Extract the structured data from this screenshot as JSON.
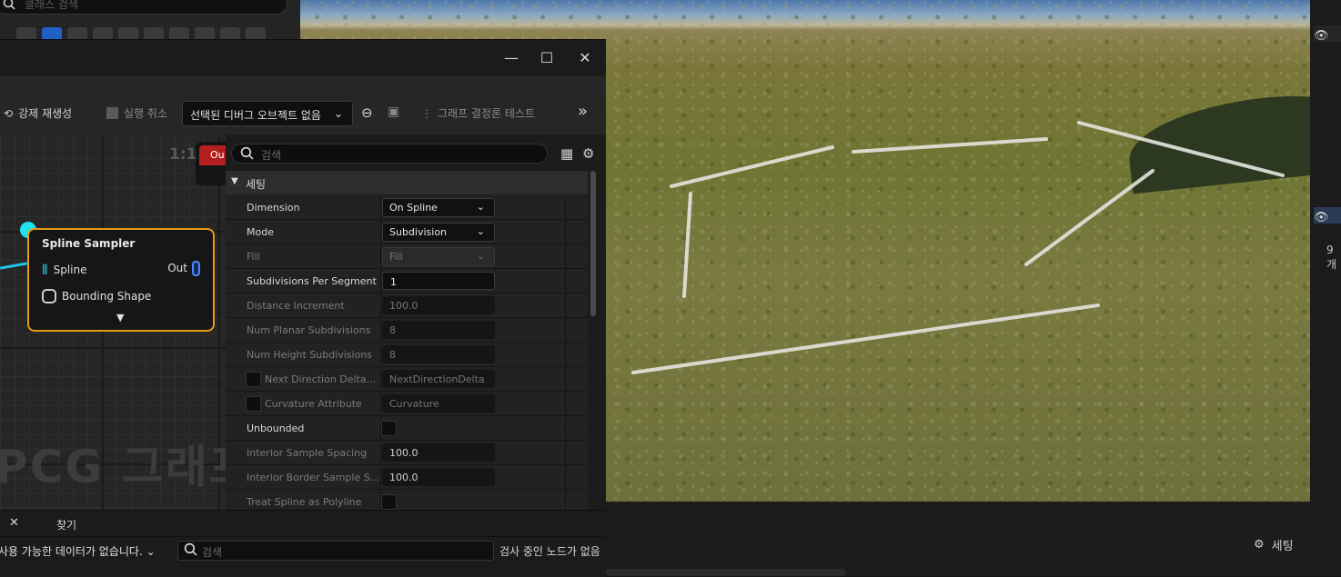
{
  "class_browser": {
    "search_placeholder": "클래스 검색"
  },
  "window": {
    "minimize": "—",
    "maximize": "☐",
    "close": "✕"
  },
  "toolbar": {
    "regenerate": "강제 재생성",
    "cancel": "실행 취소",
    "debug_object": "선택된 디버그 오브젝트 없음",
    "determinism": "그래프 결정론 테스트"
  },
  "graph": {
    "zoom": "1:1",
    "watermark": "PCG 그래프",
    "output_node_label": "Ou",
    "node": {
      "title": "Spline Sampler",
      "input_spline": "Spline",
      "input_bounding": "Bounding Shape",
      "output": "Out"
    }
  },
  "details": {
    "search_placeholder": "검색",
    "section": "세팅",
    "props": {
      "dimension": {
        "label": "Dimension",
        "value": "On Spline"
      },
      "mode": {
        "label": "Mode",
        "value": "Subdivision"
      },
      "fill": {
        "label": "Fill",
        "value": "Fill"
      },
      "subdiv": {
        "label": "Subdivisions Per Segment",
        "value": "1"
      },
      "distance": {
        "label": "Distance Increment",
        "value": "100.0"
      },
      "planar": {
        "label": "Num Planar Subdivisions",
        "value": "8"
      },
      "height": {
        "label": "Num Height Subdivisions",
        "value": "8"
      },
      "nextdir": {
        "label": "Next Direction Delta...",
        "value": "NextDirectionDelta"
      },
      "curvature": {
        "label": "Curvature Attribute",
        "value": "Curvature"
      },
      "unbounded": {
        "label": "Unbounded"
      },
      "interior": {
        "label": "Interior Sample Spacing",
        "value": "100.0"
      },
      "border": {
        "label": "Interior Border Sample S...",
        "value": "100.0"
      },
      "polyline": {
        "label": "Treat Spline as Polyline"
      }
    }
  },
  "bottom": {
    "tab_close": "✕",
    "tab_find": "찾기",
    "data_select": "사용 가능한 데이터가 없습니다.",
    "search_placeholder": "검색",
    "status": "검사 중인 노드가 없음"
  },
  "viewport": {
    "settings": "세팅"
  },
  "right_panel": {
    "count": "9개"
  }
}
